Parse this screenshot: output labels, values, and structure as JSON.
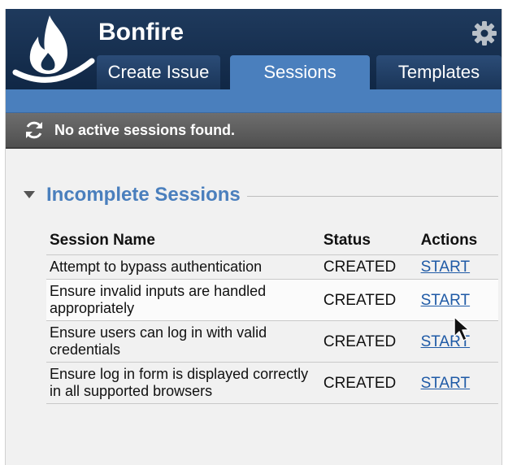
{
  "app": {
    "title": "Bonfire"
  },
  "tabs": [
    {
      "label": "Create Issue",
      "active": false
    },
    {
      "label": "Sessions",
      "active": true
    },
    {
      "label": "Templates",
      "active": false
    }
  ],
  "status_bar": {
    "message": "No active sessions found."
  },
  "section": {
    "title": "Incomplete Sessions"
  },
  "table": {
    "headers": [
      "Session Name",
      "Status",
      "Actions"
    ],
    "rows": [
      {
        "name": "Attempt to bypass authentication",
        "status": "CREATED",
        "action": "START"
      },
      {
        "name": "Ensure invalid inputs are handled appropriately",
        "status": "CREATED",
        "action": "START"
      },
      {
        "name": "Ensure users can log in with valid credentials",
        "status": "CREATED",
        "action": "START"
      },
      {
        "name": "Ensure log in form is displayed correctly in all supported browsers",
        "status": "CREATED",
        "action": "START"
      }
    ]
  },
  "colors": {
    "header_bg": "#17304f",
    "tab_active": "#4a7fbd",
    "link": "#1f5aa6",
    "section_title": "#4a7fbd",
    "status_bar_bg": "#5e5e5e"
  },
  "icons": {
    "logo": "flame-logo-icon",
    "settings": "gear-icon",
    "refresh": "refresh-icon",
    "collapse": "triangle-down-icon",
    "pointer": "mouse-cursor-icon"
  }
}
